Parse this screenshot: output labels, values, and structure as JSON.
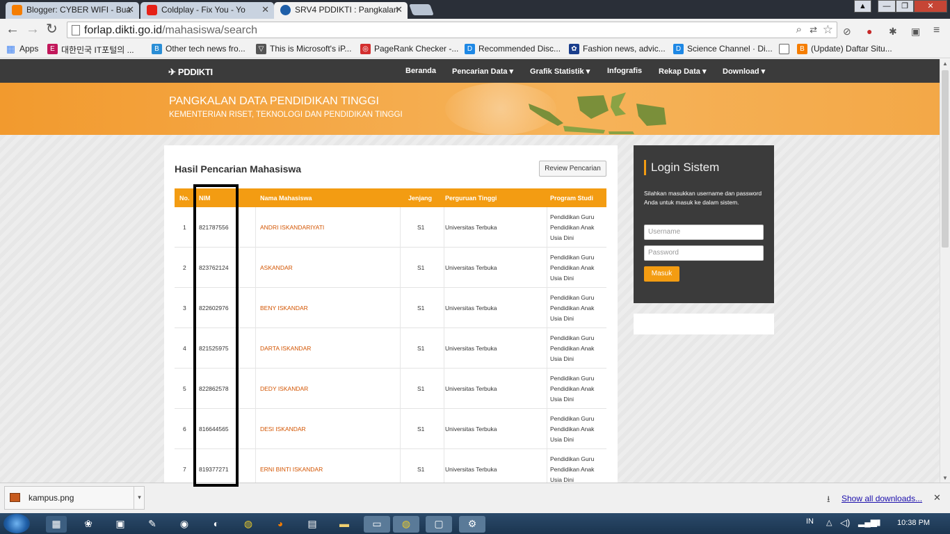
{
  "browser": {
    "tabs": [
      {
        "title": "Blogger: CYBER WIFI - Bua",
        "favicon": "blogger-icon",
        "color": "#f57d00"
      },
      {
        "title": "Coldplay - Fix You - Yo",
        "favicon": "youtube-icon",
        "color": "#e62117"
      },
      {
        "title": "SRV4 PDDIKTI : Pangkalan",
        "favicon": "pddikti-icon",
        "color": "#1f5fa8"
      }
    ],
    "url_host": "forlap.dikti.go.id",
    "url_path": "/mahasiswa/search",
    "bookmarks": [
      {
        "label": "Apps",
        "color": "#4285f4",
        "glyph": "▦"
      },
      {
        "label": "대한민국 IT포털의 ...",
        "color": "#c2185b",
        "glyph": "E"
      },
      {
        "label": "Other tech news fro...",
        "color": "#2a8ed6",
        "glyph": "B"
      },
      {
        "label": "This is Microsoft's iP...",
        "color": "#555555",
        "glyph": "▽"
      },
      {
        "label": "PageRank Checker -...",
        "color": "#d32f2f",
        "glyph": "◎"
      },
      {
        "label": "Recommended Disc...",
        "color": "#1e88e5",
        "glyph": "D"
      },
      {
        "label": "Fashion news, advic...",
        "color": "#1a3e8c",
        "glyph": "✿"
      },
      {
        "label": "Science Channel · Di...",
        "color": "#1e88e5",
        "glyph": "D"
      },
      {
        "label": "",
        "color": "#ffffff",
        "glyph": ""
      },
      {
        "label": "(Update) Daftar Situ...",
        "color": "#f57d00",
        "glyph": "B"
      }
    ]
  },
  "site": {
    "logo": "PDDIKTI",
    "nav": [
      "Beranda",
      "Pencarian Data",
      "Grafik Statistik",
      "Infografis",
      "Rekap Data",
      "Download"
    ],
    "banner_title": "PANGKALAN DATA PENDIDIKAN TINGGI",
    "banner_subtitle": "KEMENTERIAN RISET, TEKNOLOGI DAN PENDIDIKAN TINGGI"
  },
  "results": {
    "title": "Hasil Pencarian Mahasiswa",
    "review_button": "Review Pencarian",
    "columns": [
      "No.",
      "NIM",
      "Nama Mahasiswa",
      "Jenjang",
      "Perguruan Tinggi",
      "Program Studi"
    ],
    "rows": [
      {
        "no": "1",
        "nim": "821787556",
        "nama": "ANDRI ISKANDARIYATI",
        "jenjang": "S1",
        "pt": "Universitas Terbuka",
        "prodi": [
          "Pendidikan Guru",
          "Pendidikan Anak",
          "Usia Dini"
        ]
      },
      {
        "no": "2",
        "nim": "823762124",
        "nama": "ASKANDAR",
        "jenjang": "S1",
        "pt": "Universitas Terbuka",
        "prodi": [
          "Pendidikan Guru",
          "Pendidikan Anak",
          "Usia Dini"
        ]
      },
      {
        "no": "3",
        "nim": "822602976",
        "nama": "BENY ISKANDAR",
        "jenjang": "S1",
        "pt": "Universitas Terbuka",
        "prodi": [
          "Pendidikan Guru",
          "Pendidikan Anak",
          "Usia Dini"
        ]
      },
      {
        "no": "4",
        "nim": "821525975",
        "nama": "DARTA ISKANDAR",
        "jenjang": "S1",
        "pt": "Universitas Terbuka",
        "prodi": [
          "Pendidikan Guru",
          "Pendidikan Anak",
          "Usia Dini"
        ]
      },
      {
        "no": "5",
        "nim": "822862578",
        "nama": "DEDY ISKANDAR",
        "jenjang": "S1",
        "pt": "Universitas Terbuka",
        "prodi": [
          "Pendidikan Guru",
          "Pendidikan Anak",
          "Usia Dini"
        ]
      },
      {
        "no": "6",
        "nim": "816644565",
        "nama": "DESI ISKANDAR",
        "jenjang": "S1",
        "pt": "Universitas Terbuka",
        "prodi": [
          "Pendidikan Guru",
          "Pendidikan Anak",
          "Usia Dini"
        ]
      },
      {
        "no": "7",
        "nim": "819377271",
        "nama": "ERNI BINTI ISKANDAR",
        "jenjang": "S1",
        "pt": "Universitas Terbuka",
        "prodi": [
          "Pendidikan Guru",
          "Pendidikan Anak",
          "Usia Dini"
        ]
      }
    ]
  },
  "login": {
    "title": "Login Sistem",
    "text": "Silahkan masukkan username dan password Anda untuk masuk ke dalam sistem.",
    "username_placeholder": "Username",
    "password_placeholder": "Password",
    "button": "Masuk"
  },
  "downloads": {
    "file": "kampus.png",
    "show_all": "Show all downloads..."
  },
  "taskbar": {
    "lang": "IN",
    "time": "10:38 PM"
  },
  "colors": {
    "accent": "#f39c12",
    "name_link": "#d35400",
    "dark": "#3b3b3b"
  }
}
